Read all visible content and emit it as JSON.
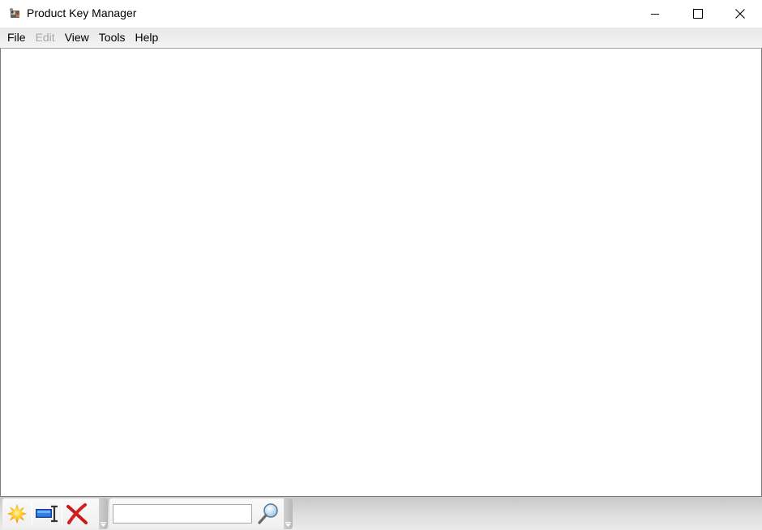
{
  "window": {
    "title": "Product Key Manager",
    "app_icon": "key-manager-app-icon",
    "controls": {
      "minimize": "minimize-icon",
      "maximize": "maximize-icon",
      "close": "close-icon"
    }
  },
  "menubar": {
    "items": [
      {
        "label": "File",
        "enabled": true
      },
      {
        "label": "Edit",
        "enabled": false
      },
      {
        "label": "View",
        "enabled": true
      },
      {
        "label": "Tools",
        "enabled": true
      },
      {
        "label": "Help",
        "enabled": true
      }
    ]
  },
  "main": {
    "items": []
  },
  "toolbar": {
    "buttons": [
      {
        "name": "new",
        "icon": "new-star-icon"
      },
      {
        "name": "rename",
        "icon": "rename-field-icon"
      },
      {
        "name": "delete",
        "icon": "delete-x-icon"
      }
    ],
    "search": {
      "value": "",
      "placeholder": "",
      "button_icon": "magnifier-icon"
    }
  }
}
